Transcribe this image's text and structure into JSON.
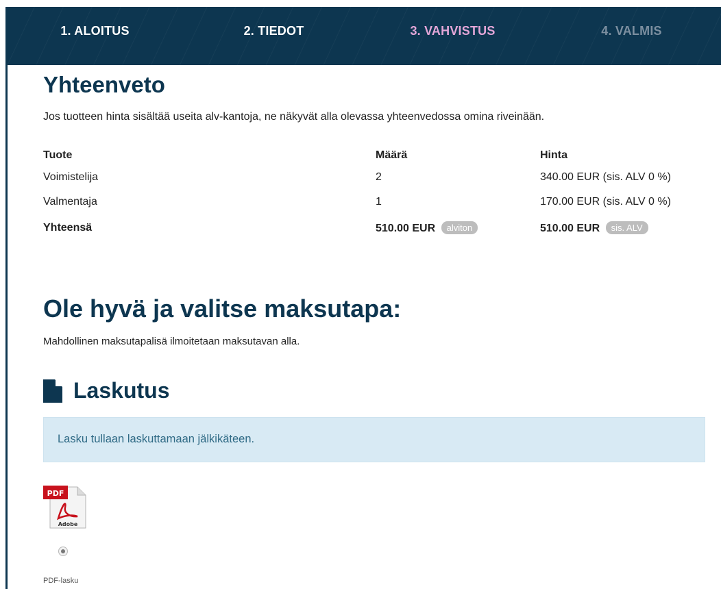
{
  "steps": [
    {
      "label": "1. ALOITUS",
      "state": "done"
    },
    {
      "label": "2. TIEDOT",
      "state": "done"
    },
    {
      "label": "3. VAHVISTUS",
      "state": "current"
    },
    {
      "label": "4. VALMIS",
      "state": "future"
    }
  ],
  "colors": {
    "brand": "#0d3650",
    "current_step": "#e3a6d8",
    "info_bg": "#d8eaf4",
    "badge": "#bdbdbd"
  },
  "summary": {
    "title": "Yhteenveto",
    "intro": "Jos tuotteen hinta sisältää useita alv-kantoja, ne näkyvät alla olevassa yhteenvedossa omina riveinään.",
    "headers": {
      "product": "Tuote",
      "quantity": "Määrä",
      "price": "Hinta"
    },
    "rows": [
      {
        "product": "Voimistelija",
        "quantity": "2",
        "price": "340.00 EUR (sis. ALV 0 %)"
      },
      {
        "product": "Valmentaja",
        "quantity": "1",
        "price": "170.00 EUR (sis. ALV 0 %)"
      }
    ],
    "total": {
      "label": "Yhteensä",
      "net": "510.00 EUR",
      "net_badge": "alviton",
      "gross": "510.00 EUR",
      "gross_badge": "sis. ALV"
    }
  },
  "payment": {
    "title": "Ole hyvä ja valitse maksutapa:",
    "note": "Mahdollinen maksutapalisä ilmoitetaan maksutavan alla.",
    "method": {
      "icon": "document-icon",
      "title": "Laskutus",
      "info": "Lasku tullaan laskuttamaan jälkikäteen.",
      "options": [
        {
          "icon": "pdf-adobe-icon",
          "label": "PDF-lasku",
          "selected": true
        }
      ]
    }
  }
}
